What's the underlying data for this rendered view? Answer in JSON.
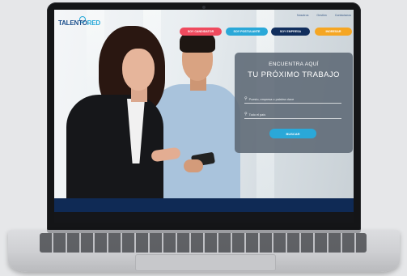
{
  "site": {
    "logo_main": "TALENTO",
    "logo_accent": "RED",
    "toplinks": [
      "Nosotros",
      "Gestión",
      "Contáctanos"
    ],
    "nav_buttons": [
      {
        "label": "SOY CANDIDATOR",
        "color": "#ef4a5e"
      },
      {
        "label": "SOY POSTULANTE",
        "color": "#2aa8d8"
      },
      {
        "label": "SOY EMPRESA",
        "color": "#112e5d"
      },
      {
        "label": "INGRESAR",
        "color": "#f5a623"
      }
    ]
  },
  "search_card": {
    "kicker": "ENCUENTRA  AQUÍ",
    "headline": "TU PRÓXIMO TRABAJO",
    "keyword_placeholder": "Puesto, empresa o palabra clave",
    "location_placeholder": "Todo el país",
    "button_label": "BUSCAR"
  },
  "icons": {
    "keyword": "search-icon",
    "location": "location-pin-icon"
  }
}
